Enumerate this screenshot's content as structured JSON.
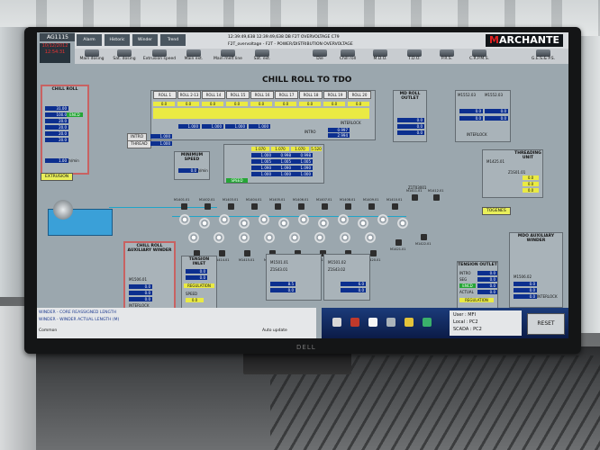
{
  "header": {
    "tab_label": "AG1115",
    "date": "10/12/2012",
    "time": "12:54:31",
    "alarm_1": "12:39:49,638  12:39:49,638  DB  F2T OVERVOLTAGE  C79",
    "alarm_2": "F2T_overvoltage - F2T - POWER/DISTRIBUTION OVERVOLTAGE",
    "logo_first": "M",
    "logo_rest": "ARCHANTE",
    "buttons": [
      "Alarm",
      "Historic",
      "Winder",
      "Trend"
    ]
  },
  "menu": [
    "Main dosing",
    "Sat. dosing",
    "Extrusion speed",
    "Main ext.",
    "Main melt line",
    "Sat. ext.",
    "Die",
    "Chill roll",
    "M.D.O.",
    "T.D.O.",
    "P.R.S.",
    "C.R.P.M.S.",
    "G.E.S.& P.S."
  ],
  "page_title": "CHILL ROLL TO TDO",
  "chill_roll_panel": {
    "title": "CHILL ROLL",
    "values": [
      "31.00",
      "100.0",
      "20.0",
      "20.0",
      "20.0",
      "20.0"
    ],
    "status": "ENCD",
    "speed": "1.00",
    "speed_unit": "m/min"
  },
  "rolls": {
    "headers": [
      "ROLL 1",
      "ROLL 2-13",
      "ROLL 14",
      "ROLL 15",
      "ROLL 16",
      "ROLL 17",
      "ROLL 18",
      "ROLL 19",
      "ROLL 20"
    ],
    "row_values": [
      "0.0",
      "0.0",
      "0.0",
      "0.0",
      "0.0",
      "0.0",
      "0.0",
      "0.0",
      "0.0"
    ],
    "interlock": "INTERLOCK",
    "intro": "INTRO",
    "thread": "THREAD",
    "intro_values": [
      "1.000",
      "1.000",
      "1.000",
      "1.000",
      "1.000",
      "1.000"
    ],
    "right_values": [
      "0.997",
      "2.994"
    ],
    "intro2": "INTRO"
  },
  "mdo_outlet": {
    "title": "MD ROLL OUTLET",
    "values": [
      "0.0",
      "0.0",
      "0.0"
    ]
  },
  "right_top": {
    "labels": [
      "M1552.03",
      "M1552.03"
    ],
    "values": [
      "0.0",
      "0.0",
      "0.0",
      "0.0"
    ],
    "interlock": "INTERLOCK"
  },
  "min_speed": {
    "title": "MINIMUM SPEED",
    "value": "0.0",
    "unit": "m/min"
  },
  "center_table": {
    "rows": [
      {
        "a": "1.000",
        "b": "0.998",
        "c": "0.998"
      },
      {
        "a": "1.005",
        "b": "1.005",
        "c": "1.005"
      },
      {
        "a": "1.090",
        "b": "1.090",
        "c": "1.090"
      },
      {
        "a": "1.000",
        "b": "1.000",
        "c": "1.000"
      }
    ],
    "top": [
      "1.070",
      "1.070",
      "1.070"
    ],
    "right": "5.520",
    "speed_label": "SPEED"
  },
  "threading_unit": {
    "title": "THREADING UNIT",
    "code": "M1425.01",
    "code2": "Z1S01.01",
    "values": [
      "0.0",
      "0.0",
      "0.0"
    ]
  },
  "tags": {
    "extrusion": "EXTRUSION",
    "to_genes": "TOGENES",
    "tension_mdo": "Z1T03001"
  },
  "chill_aux": {
    "title": "CHILL ROLL AUXILIARY WINDER",
    "code": "M1506.01",
    "values": [
      "0.0",
      "0.0",
      "0.0"
    ],
    "interlock": "INTERLOCK"
  },
  "tension_inlet": {
    "title": "TENSION INLET",
    "values": [
      "0.0",
      "0.0"
    ],
    "reg": "REGULATION",
    "speed": "SPEED",
    "speed_val": "0.0"
  },
  "setpoint_left": {
    "code": "M1501.01",
    "code2": "Z1S43.01",
    "values": [
      "8.5",
      "0.0"
    ]
  },
  "setpoint_right": {
    "code": "M1501.02",
    "code2": "Z1S43.02",
    "values": [
      "6.0",
      "0.0"
    ]
  },
  "tension_outlet": {
    "title": "TENSION OUTLET",
    "rows": [
      "INTRO",
      "SEG",
      "ENCD",
      "ACTUAL"
    ],
    "values": [
      "0.0",
      "0.0",
      "0.0",
      "0.0"
    ],
    "reg": "REGULATION"
  },
  "mdo_aux": {
    "title": "MDO AUXILIARY WINDER",
    "code": "M1506.02",
    "values": [
      "0.0",
      "0.0",
      "0.0"
    ],
    "interlock": "INTERLOCK"
  },
  "motor_labels": [
    "M1401.01",
    "M1402.01",
    "M1403.01",
    "M1404.01",
    "M1405.01",
    "M1406.01",
    "M1407.01",
    "M1408.01",
    "M1409.01",
    "M1410.01",
    "M1411.01",
    "M1412.01"
  ],
  "motor_bottom_labels": [
    "M1413.01",
    "M1414.01",
    "M1415.01",
    "M1416.01",
    "M1417.01",
    "M1418.01",
    "M1419.01",
    "M1420.01",
    "M1421.01",
    "M1422.01"
  ],
  "messages": {
    "line_1": "WINDER - CORE REASSIGNED LENGTH",
    "line_2": "WINDER - WINDER ACTUAL LENGTH (M)",
    "line_3": "Common",
    "auto_update": "Auto update"
  },
  "user": {
    "user_label": "User :",
    "user_value": "MFI",
    "local_label": "Local :",
    "local_value": "PC2",
    "scada_label": "SCADA :",
    "scada_value": "PC2"
  },
  "reset_label": "RESET",
  "monitor_brand": "DELL",
  "colors": {
    "accent": "#0c2f8f",
    "value_yellow": "#eaea43",
    "value_green": "#25a536",
    "logo_red": "#e02020"
  }
}
